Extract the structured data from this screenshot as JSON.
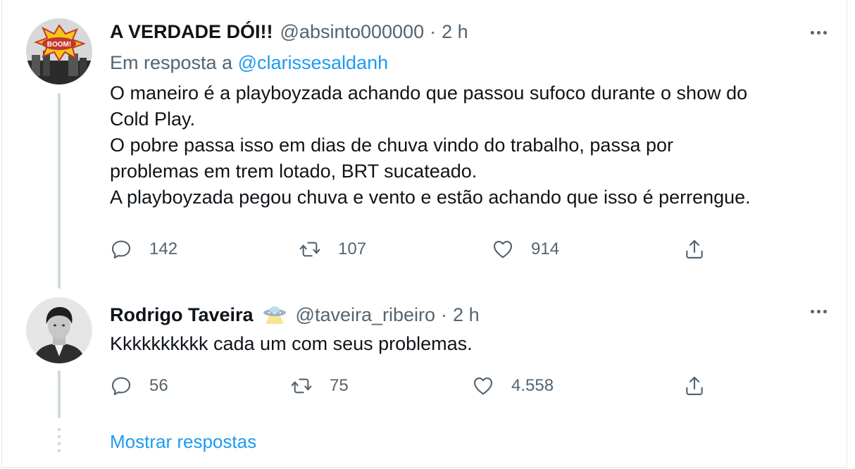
{
  "tweets": [
    {
      "author_name": "A VERDADE DÓI!!",
      "handle": "@absinto000000",
      "separator": "·",
      "time": "2 h",
      "reply_prefix": "Em resposta a",
      "reply_mention": "@clarissesaldanh",
      "lines": [
        "O maneiro é a playboyzada achando que passou sufoco durante o show do",
        "Cold Play.",
        "O pobre passa isso em dias de chuva vindo do trabalho, passa por",
        "problemas em trem lotado, BRT sucateado.",
        "A playboyzada pegou chuva e vento e estão achando que isso é perrengue."
      ],
      "replies": "142",
      "retweets": "107",
      "likes": "914",
      "avatar_icon": "boom-comic-avatar"
    },
    {
      "author_name": "Rodrigo Taveira",
      "name_badge_icon": "ufo-icon",
      "handle": "@taveira_ribeiro",
      "separator": "·",
      "time": "2 h",
      "lines": [
        "Kkkkkkkkkk cada um com seus problemas."
      ],
      "replies": "56",
      "retweets": "75",
      "likes": "4.558",
      "avatar_icon": "person-photo-avatar"
    }
  ],
  "show_replies_label": "Mostrar respostas",
  "colors": {
    "link": "#1d9bf0",
    "secondary_text": "#536471",
    "primary_text": "#0f1419",
    "thread_line": "#cfd9de"
  }
}
